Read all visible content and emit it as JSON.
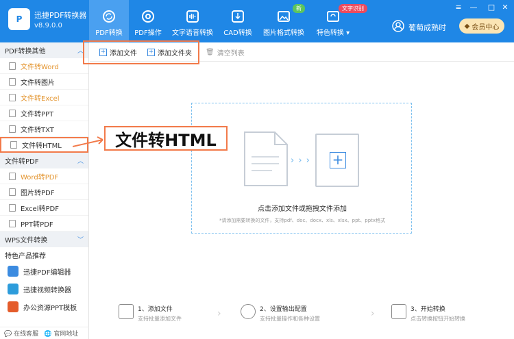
{
  "app": {
    "name": "迅捷PDF转换器",
    "version": "v8.9.0.0",
    "logo_text": "P"
  },
  "tabs": [
    {
      "label": "PDF转换",
      "icon": "refresh-icon"
    },
    {
      "label": "PDF操作",
      "icon": "gear-icon"
    },
    {
      "label": "文字语音转换",
      "icon": "audio-icon"
    },
    {
      "label": "CAD转换",
      "icon": "cad-icon"
    },
    {
      "label": "图片格式转换",
      "icon": "image-icon"
    },
    {
      "label": "特色转换",
      "icon": "special-icon"
    }
  ],
  "badges": {
    "new": "新",
    "ocr": "文字识别"
  },
  "user": {
    "name": "葡萄成熟时",
    "member_label": "会员中心"
  },
  "window_controls": {
    "menu": "≡",
    "minimize": "—",
    "maximize": "□",
    "close": "✕"
  },
  "sidebar": {
    "groups": [
      {
        "title": "PDF转换其他",
        "items": [
          "文件转Word",
          "文件转图片",
          "文件转Excel",
          "文件转PPT",
          "文件转TXT",
          "文件转HTML"
        ]
      },
      {
        "title": "文件转PDF",
        "items": [
          "Word转PDF",
          "图片转PDF",
          "Excel转PDF",
          "PPT转PDF"
        ]
      },
      {
        "title": "WPS文件转换",
        "items": []
      }
    ],
    "featured_title": "特色产品推荐",
    "products": [
      "迅捷PDF编辑器",
      "迅捷视频转换器",
      "办公资源PPT模板"
    ],
    "footer": {
      "service": "在线客服",
      "website": "官网地址"
    }
  },
  "toolbar": {
    "add_file": "添加文件",
    "add_folder": "添加文件夹",
    "clear_list": "清空列表"
  },
  "dropzone": {
    "main_text": "点击添加文件或拖拽文件添加",
    "hint": "*请添加需要转换的文件，支持pdf、doc、docx、xls、xlsx、ppt、pptx格式"
  },
  "callout": {
    "text": "文件转HTML"
  },
  "steps": [
    {
      "title": "1、添加文件",
      "desc": "支持批量添加文件"
    },
    {
      "title": "2、设置输出配置",
      "desc": "支持批量操作和各种设置"
    },
    {
      "title": "3、开始转换",
      "desc": "点击转换按钮开始转换"
    }
  ],
  "colors": {
    "primary": "#1f87e6",
    "accent": "#f27a4a",
    "orange_text": "#e3942e",
    "badge_new": "#5dc55d",
    "badge_ocr": "#ec4b5e"
  }
}
